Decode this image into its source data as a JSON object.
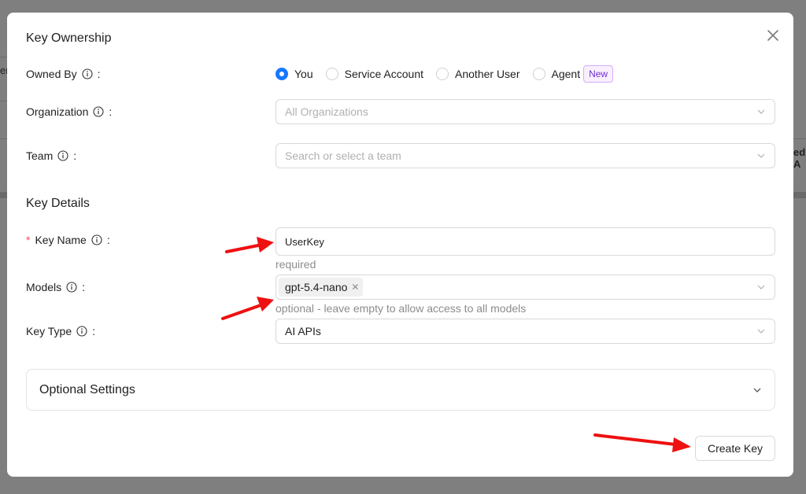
{
  "background": {
    "left_fragment": "er",
    "right_fragment": "ed A"
  },
  "modal": {
    "ownership_title": "Key Ownership",
    "owned_by": {
      "label": "Owned By",
      "options": [
        "You",
        "Service Account",
        "Another User",
        "Agent"
      ],
      "selected": "You",
      "new_badge": "New"
    },
    "organization": {
      "label": "Organization",
      "placeholder": "All Organizations"
    },
    "team": {
      "label": "Team",
      "placeholder": "Search or select a team"
    },
    "details_title": "Key Details",
    "key_name": {
      "label": "Key Name",
      "required_mark": "*",
      "value": "UserKey",
      "help": "required"
    },
    "models": {
      "label": "Models",
      "tag": "gpt-5.4-nano",
      "help": "optional - leave empty to allow access to all models"
    },
    "key_type": {
      "label": "Key Type",
      "value": "AI APIs"
    },
    "optional_settings": "Optional Settings",
    "create_button": "Create Key",
    "colon": ":"
  },
  "colors": {
    "accent": "#1677ff",
    "annotation_arrow": "#ee1111",
    "badge_purple": "#722ed1"
  },
  "icons": [
    "close-icon",
    "info-icon",
    "chevron-down-icon",
    "tag-close-icon"
  ]
}
